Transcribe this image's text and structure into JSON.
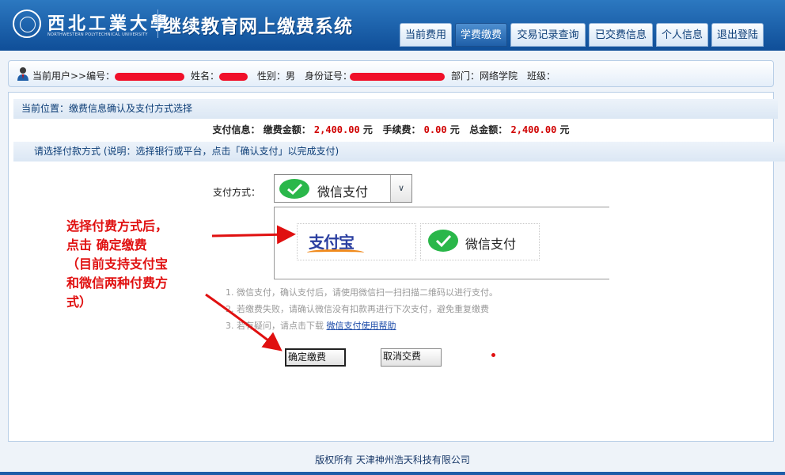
{
  "header": {
    "logo_cn": "西北工業大學",
    "logo_en": "NORTHWESTERN POLYTECHNICAL UNIVERSITY",
    "system_title": "继续教育网上缴费系统"
  },
  "nav": {
    "tabs": [
      {
        "label": "当前费用",
        "active": false
      },
      {
        "label": "学费缴费",
        "active": true
      },
      {
        "label": "交易记录查询",
        "active": false
      },
      {
        "label": "已交费信息",
        "active": false
      },
      {
        "label": "个人信息",
        "active": false
      },
      {
        "label": "退出登陆",
        "active": false
      }
    ]
  },
  "user_bar": {
    "current_user_label": "当前用户>>编号：",
    "name_label": "姓名：",
    "gender_label": "性别：",
    "gender_value": "男",
    "id_label": "身份证号：",
    "dept_label": "部门：",
    "dept_value": "网络学院",
    "class_label": "班级："
  },
  "location": {
    "text": "当前位置：缴费信息确认及支付方式选择"
  },
  "pay_info": {
    "label": "支付信息：",
    "amount_label": "缴费金额：",
    "amount": "2,400.00",
    "fee_label": "手续费：",
    "fee": "0.00",
    "total_label": "总金额：",
    "total": "2,400.00",
    "unit": "元"
  },
  "choose": {
    "text": "请选择付款方式 (说明：选择银行或平台，点击「确认支付」以完成支付)"
  },
  "payment": {
    "method_label": "支付方式：",
    "selected": "微信支付",
    "options": [
      {
        "label": "支付宝"
      },
      {
        "label": "微信支付"
      }
    ]
  },
  "notes": {
    "line1": "1. 微信支付，确认支付后，请使用微信扫一扫扫描二维码以进行支付。",
    "line2": "2. 若缴费失败，请确认微信没有扣款再进行下次支付，避免重复缴费",
    "line3_prefix": "3. 若有疑问，请点击下载",
    "line3_link": "微信支付使用帮助"
  },
  "buttons": {
    "confirm": "确定缴费",
    "cancel": "取消交费"
  },
  "annotation": {
    "line1": "选择付费方式后，",
    "line2": "点击 确定缴费",
    "line3": "（目前支持支付宝",
    "line4": "和微信两种付费方",
    "line5": "式）"
  },
  "footer": {
    "prefix": "版权所有",
    "company": "天津神州浩天科技有限公司"
  },
  "colors": {
    "header_blue": "#1f5fa8",
    "amount_red": "#d00000",
    "annotation_red": "#e01010",
    "wechat_green": "#2ab74a",
    "alipay_blue": "#2a3ea0"
  }
}
